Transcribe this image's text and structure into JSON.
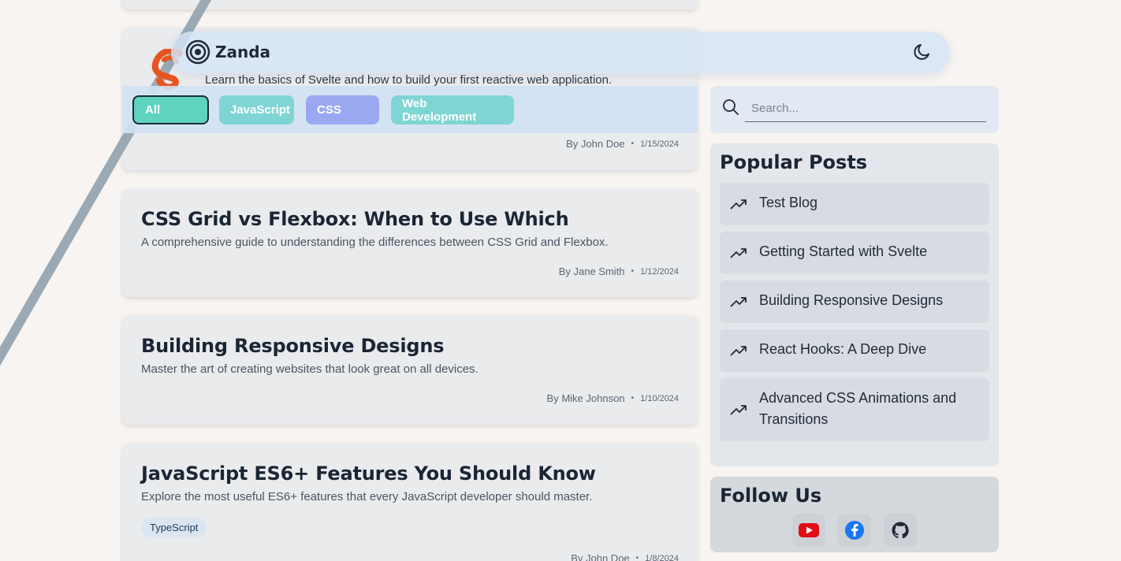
{
  "header": {
    "brand": "Zanda"
  },
  "filters": [
    {
      "label": "All",
      "color": "#5ed3bf",
      "active": true
    },
    {
      "label": "JavaScript",
      "color": "#7fd5d4"
    },
    {
      "label": "CSS",
      "color": "#9aa8f2"
    },
    {
      "label": "Web Development",
      "color": "#7fd5d4"
    }
  ],
  "posts": [
    {
      "title": "",
      "description": "Learn the basics of Svelte and how to build your first reactive web application.",
      "author": "By John Doe",
      "date": "1/15/2024"
    },
    {
      "title": "CSS Grid vs Flexbox: When to Use Which",
      "description": "A comprehensive guide to understanding the differences between CSS Grid and Flexbox.",
      "author": "By Jane Smith",
      "date": "1/12/2024"
    },
    {
      "title": "Building Responsive Designs",
      "description": "Master the art of creating websites that look great on all devices.",
      "author": "By Mike Johnson",
      "date": "1/10/2024"
    },
    {
      "title": "JavaScript ES6+ Features You Should Know",
      "description": "Explore the most useful ES6+ features that every JavaScript developer should master.",
      "tag": "TypeScript",
      "author": "By John Doe",
      "date": "1/8/2024"
    }
  ],
  "search": {
    "placeholder": "Search..."
  },
  "popular": {
    "title": "Popular Posts",
    "items": [
      "Test Blog",
      "Getting Started with Svelte",
      "Building Responsive Designs",
      "React Hooks: A Deep Dive",
      "Advanced CSS Animations and Transitions"
    ]
  },
  "follow": {
    "title": "Follow Us",
    "icons": [
      "youtube-icon",
      "facebook-icon",
      "github-icon"
    ]
  }
}
